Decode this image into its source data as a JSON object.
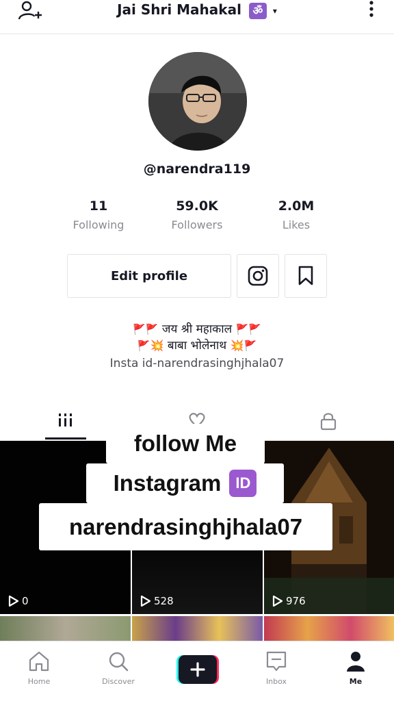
{
  "header": {
    "title": "Jai Shri Mahakal",
    "om_symbol": "ॐ",
    "caret": "▾"
  },
  "profile": {
    "username": "@narendra119",
    "stats": [
      {
        "value": "11",
        "label": "Following"
      },
      {
        "value": "59.0K",
        "label": "Followers"
      },
      {
        "value": "2.0M",
        "label": "Likes"
      }
    ],
    "edit_label": "Edit profile",
    "bio_line1": "जय श्री महाकाल",
    "bio_line2": "बाबा भोलेनाथ",
    "bio_line3": "Insta id-narendrasinghjhala07"
  },
  "videos": [
    {
      "views": "0"
    },
    {
      "views": "528"
    },
    {
      "views": "976"
    }
  ],
  "overlay": {
    "line1": "follow Me",
    "line2": "Instagram",
    "id_badge": "ID",
    "line3": "narendrasinghjhala07"
  },
  "nav": {
    "home": "Home",
    "discover": "Discover",
    "inbox": "Inbox",
    "me": "Me"
  }
}
